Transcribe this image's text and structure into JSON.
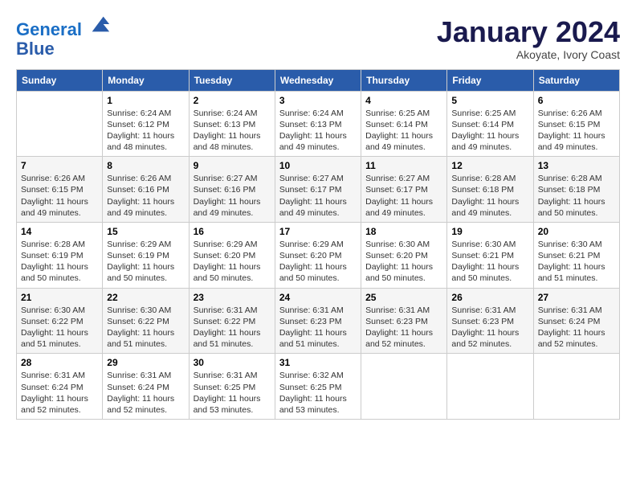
{
  "header": {
    "logo_line1": "General",
    "logo_line2": "Blue",
    "month_title": "January 2024",
    "subtitle": "Akoyate, Ivory Coast"
  },
  "days_of_week": [
    "Sunday",
    "Monday",
    "Tuesday",
    "Wednesday",
    "Thursday",
    "Friday",
    "Saturday"
  ],
  "weeks": [
    [
      {
        "day": "",
        "info": ""
      },
      {
        "day": "1",
        "info": "Sunrise: 6:24 AM\nSunset: 6:12 PM\nDaylight: 11 hours\nand 48 minutes."
      },
      {
        "day": "2",
        "info": "Sunrise: 6:24 AM\nSunset: 6:13 PM\nDaylight: 11 hours\nand 48 minutes."
      },
      {
        "day": "3",
        "info": "Sunrise: 6:24 AM\nSunset: 6:13 PM\nDaylight: 11 hours\nand 49 minutes."
      },
      {
        "day": "4",
        "info": "Sunrise: 6:25 AM\nSunset: 6:14 PM\nDaylight: 11 hours\nand 49 minutes."
      },
      {
        "day": "5",
        "info": "Sunrise: 6:25 AM\nSunset: 6:14 PM\nDaylight: 11 hours\nand 49 minutes."
      },
      {
        "day": "6",
        "info": "Sunrise: 6:26 AM\nSunset: 6:15 PM\nDaylight: 11 hours\nand 49 minutes."
      }
    ],
    [
      {
        "day": "7",
        "info": "Sunrise: 6:26 AM\nSunset: 6:15 PM\nDaylight: 11 hours\nand 49 minutes."
      },
      {
        "day": "8",
        "info": "Sunrise: 6:26 AM\nSunset: 6:16 PM\nDaylight: 11 hours\nand 49 minutes."
      },
      {
        "day": "9",
        "info": "Sunrise: 6:27 AM\nSunset: 6:16 PM\nDaylight: 11 hours\nand 49 minutes."
      },
      {
        "day": "10",
        "info": "Sunrise: 6:27 AM\nSunset: 6:17 PM\nDaylight: 11 hours\nand 49 minutes."
      },
      {
        "day": "11",
        "info": "Sunrise: 6:27 AM\nSunset: 6:17 PM\nDaylight: 11 hours\nand 49 minutes."
      },
      {
        "day": "12",
        "info": "Sunrise: 6:28 AM\nSunset: 6:18 PM\nDaylight: 11 hours\nand 49 minutes."
      },
      {
        "day": "13",
        "info": "Sunrise: 6:28 AM\nSunset: 6:18 PM\nDaylight: 11 hours\nand 50 minutes."
      }
    ],
    [
      {
        "day": "14",
        "info": "Sunrise: 6:28 AM\nSunset: 6:19 PM\nDaylight: 11 hours\nand 50 minutes."
      },
      {
        "day": "15",
        "info": "Sunrise: 6:29 AM\nSunset: 6:19 PM\nDaylight: 11 hours\nand 50 minutes."
      },
      {
        "day": "16",
        "info": "Sunrise: 6:29 AM\nSunset: 6:20 PM\nDaylight: 11 hours\nand 50 minutes."
      },
      {
        "day": "17",
        "info": "Sunrise: 6:29 AM\nSunset: 6:20 PM\nDaylight: 11 hours\nand 50 minutes."
      },
      {
        "day": "18",
        "info": "Sunrise: 6:30 AM\nSunset: 6:20 PM\nDaylight: 11 hours\nand 50 minutes."
      },
      {
        "day": "19",
        "info": "Sunrise: 6:30 AM\nSunset: 6:21 PM\nDaylight: 11 hours\nand 50 minutes."
      },
      {
        "day": "20",
        "info": "Sunrise: 6:30 AM\nSunset: 6:21 PM\nDaylight: 11 hours\nand 51 minutes."
      }
    ],
    [
      {
        "day": "21",
        "info": "Sunrise: 6:30 AM\nSunset: 6:22 PM\nDaylight: 11 hours\nand 51 minutes."
      },
      {
        "day": "22",
        "info": "Sunrise: 6:30 AM\nSunset: 6:22 PM\nDaylight: 11 hours\nand 51 minutes."
      },
      {
        "day": "23",
        "info": "Sunrise: 6:31 AM\nSunset: 6:22 PM\nDaylight: 11 hours\nand 51 minutes."
      },
      {
        "day": "24",
        "info": "Sunrise: 6:31 AM\nSunset: 6:23 PM\nDaylight: 11 hours\nand 51 minutes."
      },
      {
        "day": "25",
        "info": "Sunrise: 6:31 AM\nSunset: 6:23 PM\nDaylight: 11 hours\nand 52 minutes."
      },
      {
        "day": "26",
        "info": "Sunrise: 6:31 AM\nSunset: 6:23 PM\nDaylight: 11 hours\nand 52 minutes."
      },
      {
        "day": "27",
        "info": "Sunrise: 6:31 AM\nSunset: 6:24 PM\nDaylight: 11 hours\nand 52 minutes."
      }
    ],
    [
      {
        "day": "28",
        "info": "Sunrise: 6:31 AM\nSunset: 6:24 PM\nDaylight: 11 hours\nand 52 minutes."
      },
      {
        "day": "29",
        "info": "Sunrise: 6:31 AM\nSunset: 6:24 PM\nDaylight: 11 hours\nand 52 minutes."
      },
      {
        "day": "30",
        "info": "Sunrise: 6:31 AM\nSunset: 6:25 PM\nDaylight: 11 hours\nand 53 minutes."
      },
      {
        "day": "31",
        "info": "Sunrise: 6:32 AM\nSunset: 6:25 PM\nDaylight: 11 hours\nand 53 minutes."
      },
      {
        "day": "",
        "info": ""
      },
      {
        "day": "",
        "info": ""
      },
      {
        "day": "",
        "info": ""
      }
    ]
  ]
}
